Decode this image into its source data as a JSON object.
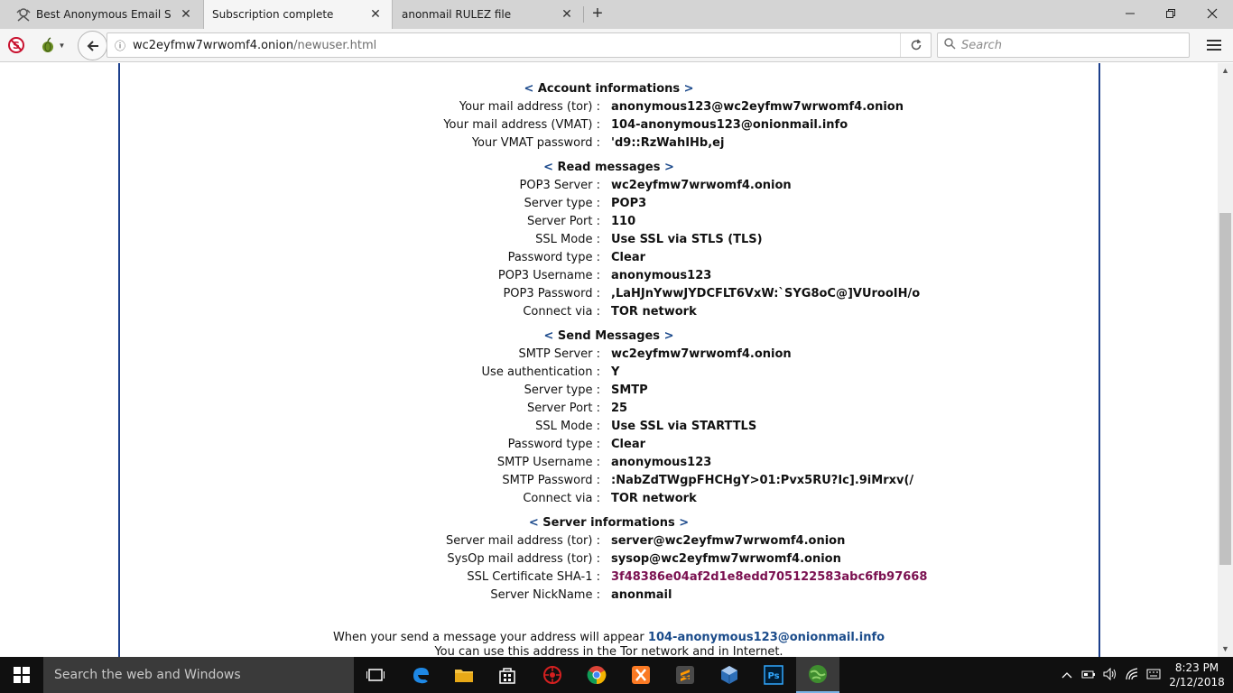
{
  "browser": {
    "tabs": [
      {
        "title": "Best Anonymous Email Se...",
        "icon": "anonymous-mask-icon",
        "active": false
      },
      {
        "title": "Subscription complete",
        "icon": "",
        "active": true
      },
      {
        "title": "anonmail RULEZ file",
        "icon": "",
        "active": false
      }
    ],
    "new_tab": "+",
    "url_host": "wc2eyfmw7wrwomf4.onion",
    "url_path": "/newuser.html",
    "search_placeholder": "Search"
  },
  "page": {
    "account": {
      "heading": "Account informations",
      "rows": [
        {
          "label": "Your mail address (tor)",
          "value": "anonymous123@wc2eyfmw7wrwomf4.onion"
        },
        {
          "label": "Your mail address (VMAT)",
          "value": "104-anonymous123@onionmail.info"
        },
        {
          "label": "Your VMAT password",
          "value": "'d9::RzWahIHb,ej"
        }
      ]
    },
    "read": {
      "heading": "Read messages",
      "rows": [
        {
          "label": "POP3 Server",
          "value": "wc2eyfmw7wrwomf4.onion"
        },
        {
          "label": "Server type",
          "value": "POP3"
        },
        {
          "label": "Server Port",
          "value": "110"
        },
        {
          "label": "SSL Mode",
          "value": "Use SSL via STLS (TLS)"
        },
        {
          "label": "Password type",
          "value": "Clear"
        },
        {
          "label": "POP3 Username",
          "value": "anonymous123"
        },
        {
          "label": "POP3 Password",
          "value": ",LaHJnYwwJYDCFLT6VxW:`SYG8oC@]VUrooIH/o"
        },
        {
          "label": "Connect via",
          "value": "TOR network"
        }
      ]
    },
    "send": {
      "heading": "Send Messages",
      "rows": [
        {
          "label": "SMTP Server",
          "value": "wc2eyfmw7wrwomf4.onion"
        },
        {
          "label": "Use authentication",
          "value": "Y"
        },
        {
          "label": "Server type",
          "value": "SMTP"
        },
        {
          "label": "Server Port",
          "value": "25"
        },
        {
          "label": "SSL Mode",
          "value": "Use SSL via STARTTLS"
        },
        {
          "label": "Password type",
          "value": "Clear"
        },
        {
          "label": "SMTP Username",
          "value": "anonymous123"
        },
        {
          "label": "SMTP Password",
          "value": ":NabZdTWgpFHCHgY>01:Pvx5RU?Ic].9iMrxv(/"
        },
        {
          "label": "Connect via",
          "value": "TOR network"
        }
      ]
    },
    "server": {
      "heading": "Server informations",
      "rows": [
        {
          "label": "Server mail address (tor)",
          "value": "server@wc2eyfmw7wrwomf4.onion"
        },
        {
          "label": "SysOp mail address (tor)",
          "value": "sysop@wc2eyfmw7wrwomf4.onion"
        },
        {
          "label": "SSL Certificate SHA-1",
          "value": "3f48386e04af2d1e8edd705122583abc6fb97668"
        },
        {
          "label": "Server NickName",
          "value": "anonmail"
        }
      ]
    },
    "footer_text": "When your send a message your address will appear",
    "footer_address": "104-anonymous123@onionmail.info",
    "footer_line2": "You can use this address in the Tor network and in Internet."
  },
  "taskbar": {
    "search_placeholder": "Search the web and Windows",
    "time": "8:23 PM",
    "date": "2/12/2018"
  },
  "colors": {
    "panel_border": "#1c3f8c",
    "heading_bracket": "#1c4a8c",
    "certificate": "#7a1050",
    "footer_address": "#1a4b8a"
  }
}
